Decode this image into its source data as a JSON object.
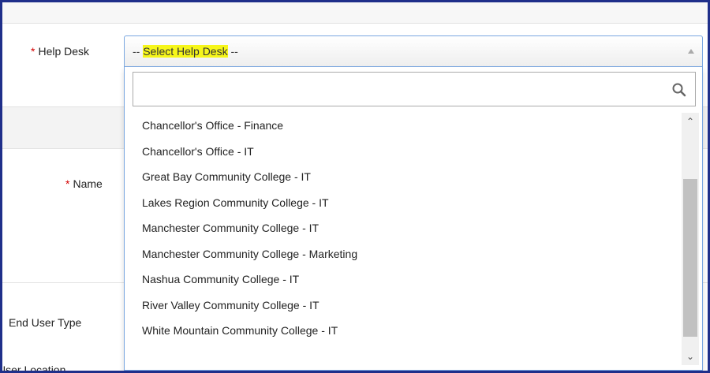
{
  "form": {
    "help_desk_label": "Help Desk",
    "name_label": "Name",
    "end_user_type_label": "End User Type",
    "user_location_label": "User Location",
    "required_mark": "*"
  },
  "help_desk_select": {
    "placeholder_prefix": "-- ",
    "placeholder_highlight": "Select Help Desk",
    "placeholder_suffix": " --",
    "search_value": "",
    "options": [
      "Chancellor's Office - Finance",
      "Chancellor's Office - IT",
      "Great Bay Community College - IT",
      "Lakes Region Community College - IT",
      "Manchester Community College - IT",
      "Manchester Community College - Marketing",
      "Nashua Community College - IT",
      "River Valley Community College - IT",
      "White Mountain Community College - IT"
    ]
  },
  "colors": {
    "highlight": "#f6f61a",
    "required": "#d40000",
    "frame": "#1f2f8a"
  },
  "icons": {
    "search": "search-icon",
    "select_arrow": "triangle-up-icon",
    "scroll_up": "chevron-up-icon",
    "scroll_down": "chevron-down-icon"
  }
}
